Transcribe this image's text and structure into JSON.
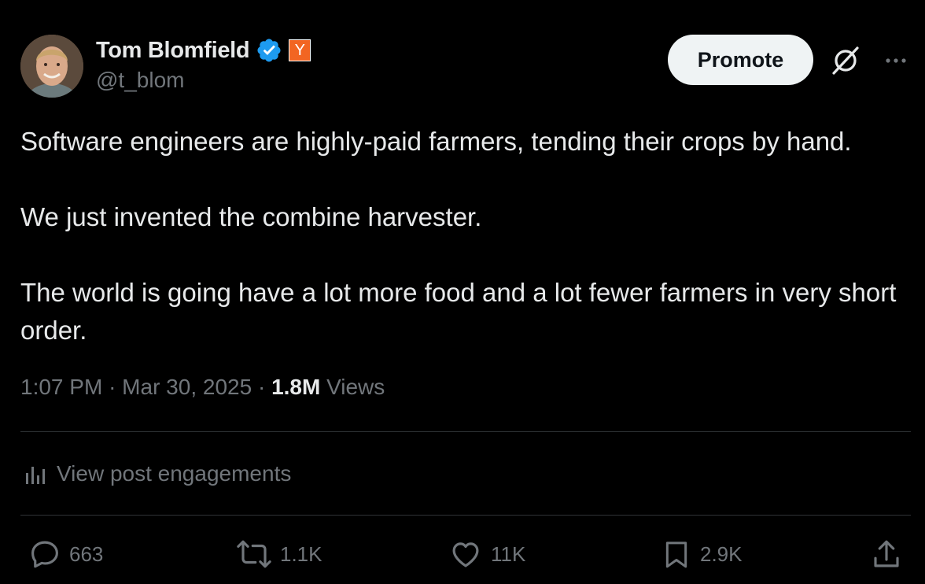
{
  "author": {
    "display_name": "Tom Blomfield",
    "handle": "@t_blom",
    "verified_icon": "verified-badge-icon",
    "affiliate_badge": "Y",
    "affiliate_badge_color": "#f26522"
  },
  "header": {
    "promote_label": "Promote",
    "grok_icon": "grok-icon",
    "more_icon": "more-horizontal-icon"
  },
  "tweet": {
    "paragraphs": [
      "Software engineers are highly-paid farmers, tending their crops by hand.",
      "We just invented the combine harvester.",
      "The world is going have a lot more food and a lot fewer farmers in very short order."
    ],
    "time": "1:07 PM",
    "date": "Mar 30, 2025",
    "separator": "·",
    "views_count": "1.8M",
    "views_label": "Views"
  },
  "engagements": {
    "label": "View post engagements",
    "icon": "analytics-icon"
  },
  "actions": {
    "replies": "663",
    "reposts": "1.1K",
    "likes": "11K",
    "bookmarks": "2.9K",
    "share_icon": "share-icon"
  },
  "colors": {
    "background": "#000000",
    "text_primary": "#e7e9ea",
    "text_secondary": "#71767b",
    "verified_blue": "#1d9bf0",
    "divider": "#2f3336",
    "promote_bg": "#eff3f4"
  }
}
